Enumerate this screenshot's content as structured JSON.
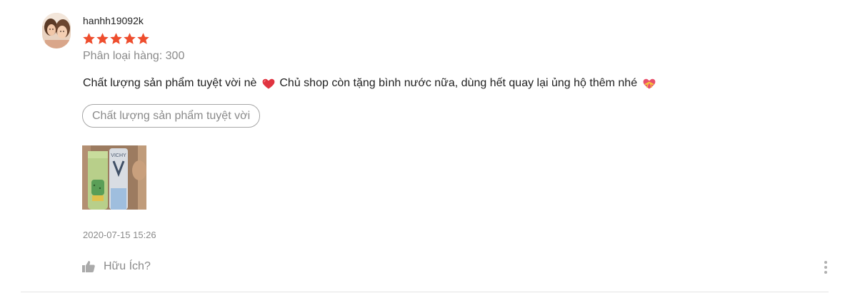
{
  "review": {
    "username": "hanhh19092k",
    "rating": 5,
    "rating_max": 5,
    "star_color": "#ee4d2d",
    "variation": "Phân loại hàng: 300",
    "comment_part1": "Chất lượng sản phẩm tuyệt vời nè",
    "comment_part2": "Chủ shop còn tặng bình nước nữa, dùng hết quay lại ủng hộ thêm nhé",
    "emoji_1": "red-heart-icon",
    "emoji_2": "heart-with-ribbon-icon",
    "tag_label": "Chất lượng sản phẩm tuyệt vời",
    "timestamp": "2020-07-15 15:26",
    "helpful_label": "Hữu Ích?",
    "photo_text": "VICHY"
  }
}
